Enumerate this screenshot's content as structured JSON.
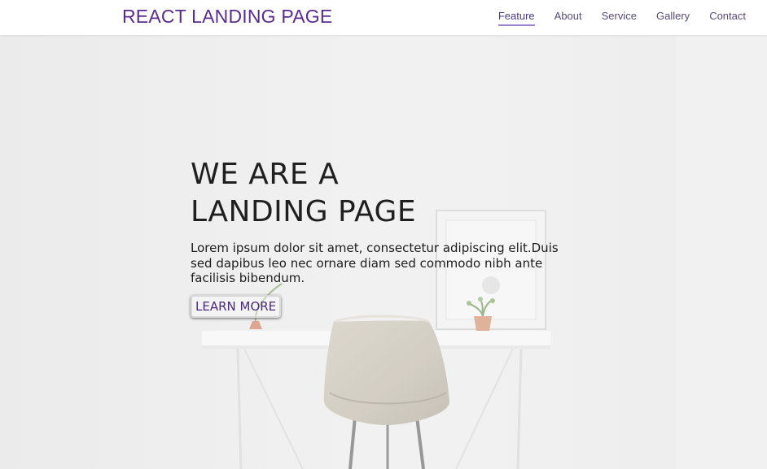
{
  "navbar": {
    "brand": "REACT LANDING PAGE",
    "links": [
      {
        "label": "Feature",
        "active": true
      },
      {
        "label": "About",
        "active": false
      },
      {
        "label": "Service",
        "active": false
      },
      {
        "label": "Gallery",
        "active": false
      },
      {
        "label": "Contact",
        "active": false
      }
    ]
  },
  "hero": {
    "title": "WE ARE A LANDING PAGE",
    "text": "Lorem ipsum dolor sit amet, consectetur adipiscing elit.Duis sed dapibus leo nec ornare diam sed commodo nibh ante facilisis bibendum.",
    "button_label": "LEARN MORE"
  },
  "colors": {
    "brand": "#5b2d8e",
    "nav_link": "#5a4a78",
    "active_underline": "#9b86cf",
    "title": "#1f1f1f",
    "button_text": "#4b2a7e"
  }
}
